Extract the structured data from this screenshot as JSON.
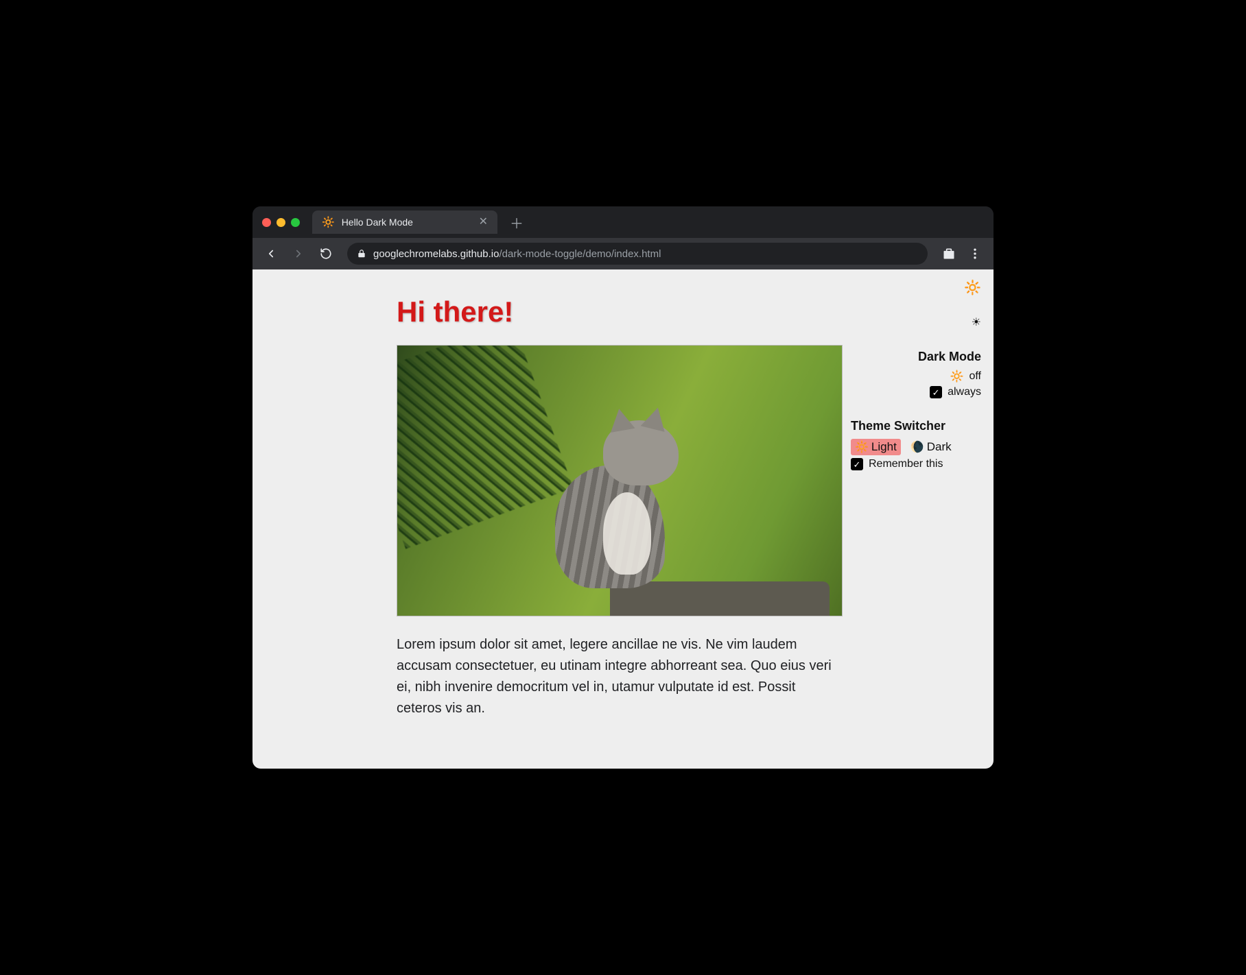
{
  "browser": {
    "tab": {
      "favicon": "🔆",
      "title": "Hello Dark Mode"
    },
    "url_host": "googlechromelabs.github.io",
    "url_path": "/dark-mode-toggle/demo/index.html"
  },
  "page": {
    "heading": "Hi there!",
    "paragraph": "Lorem ipsum dolor sit amet, legere ancillae ne vis. Ne vim laudem accusam consectetuer, eu utinam integre abhorreant sea. Quo eius veri ei, nibh invenire democritum vel in, utamur vulputate id est. Possit ceteros vis an."
  },
  "icons": {
    "corner_sun": "🔆",
    "corner_brightness": "☀"
  },
  "dark_mode_widget": {
    "title": "Dark Mode",
    "status_icon": "🔆",
    "status_label": "off",
    "checkbox_label": "always",
    "checkbox_checked": true
  },
  "theme_switcher": {
    "title": "Theme Switcher",
    "options": [
      {
        "icon": "🔆",
        "label": "Light",
        "active": true
      },
      {
        "icon": "🌘",
        "label": "Dark",
        "active": false
      }
    ],
    "remember_label": "Remember this",
    "remember_checked": true
  }
}
